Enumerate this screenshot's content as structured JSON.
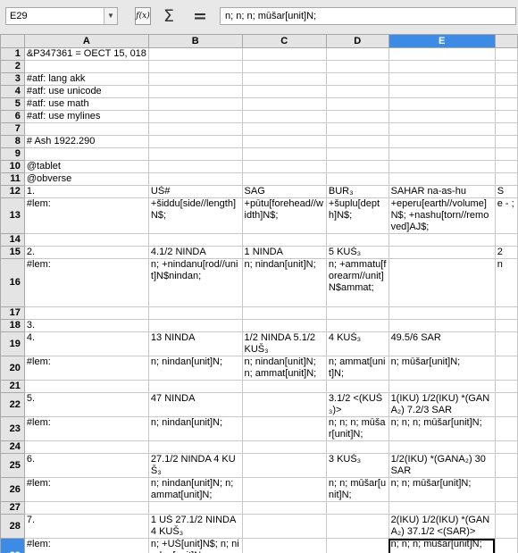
{
  "toolbar": {
    "name_box": "E29",
    "fx_icon": "f(x)",
    "sum_icon": "Σ",
    "equals_icon": "=",
    "formula": "n; n; n; mūšar[unit]N;"
  },
  "columns": [
    "A",
    "B",
    "C",
    "D",
    "E",
    ""
  ],
  "selected_column": "E",
  "selected_row": "29",
  "rows": [
    {
      "num": "1",
      "cells": [
        "&P347361 = OECT 15, 018",
        "",
        "",
        "",
        "",
        ""
      ]
    },
    {
      "num": "2",
      "cells": [
        "",
        "",
        "",
        "",
        "",
        ""
      ]
    },
    {
      "num": "3",
      "cells": [
        "#atf: lang akk",
        "",
        "",
        "",
        "",
        ""
      ]
    },
    {
      "num": "4",
      "cells": [
        "#atf: use unicode",
        "",
        "",
        "",
        "",
        ""
      ]
    },
    {
      "num": "5",
      "cells": [
        "#atf: use math",
        "",
        "",
        "",
        "",
        ""
      ]
    },
    {
      "num": "6",
      "cells": [
        "#atf: use mylines",
        "",
        "",
        "",
        "",
        ""
      ]
    },
    {
      "num": "7",
      "cells": [
        "",
        "",
        "",
        "",
        "",
        ""
      ]
    },
    {
      "num": "8",
      "cells": [
        "# Ash 1922.290",
        "",
        "",
        "",
        "",
        ""
      ]
    },
    {
      "num": "9",
      "cells": [
        "",
        "",
        "",
        "",
        "",
        ""
      ]
    },
    {
      "num": "10",
      "cells": [
        "@tablet",
        "",
        "",
        "",
        "",
        ""
      ]
    },
    {
      "num": "11",
      "cells": [
        "@obverse",
        "",
        "",
        "",
        "",
        ""
      ]
    },
    {
      "num": "12",
      "cells": [
        "1.",
        "UŠ#",
        "SAG",
        "BUR₃",
        "SAHAR na-as-hu",
        "S"
      ]
    },
    {
      "num": "13",
      "cells": [
        "#lem:",
        "+šiddu[side//length]N$;",
        "+pūtu[forehead//width]N$;",
        "+šuplu[depth]N$;",
        "+eperu[earth//volume]N$; +nashu[torn//removed]AJ$;",
        "e - ;"
      ]
    },
    {
      "num": "14",
      "cells": [
        "",
        "",
        "",
        "",
        "",
        ""
      ]
    },
    {
      "num": "15",
      "cells": [
        "2.",
        "4.1/2 NINDA",
        "1 NINDA",
        "5 KUŠ₃",
        "",
        "2"
      ]
    },
    {
      "num": "16",
      "cells": [
        "#lem:",
        "n; +nindanu[rod//unit]N$nindan;",
        "n; nindan[unit]N;",
        "n; +ammatu[forearm//unit]N$ammat;",
        "",
        "n"
      ]
    },
    {
      "num": "17",
      "cells": [
        "",
        "",
        "",
        "",
        "",
        ""
      ]
    },
    {
      "num": "18",
      "cells": [
        "3.",
        "",
        "",
        "",
        "",
        ""
      ]
    },
    {
      "num": "19",
      "cells": [
        "4.",
        "13 NINDA",
        "1/2 NINDA 5.1/2 KUŠ₃",
        "4 KUŠ₃",
        "49.5/6 SAR",
        ""
      ]
    },
    {
      "num": "20",
      "cells": [
        "#lem:",
        "n; nindan[unit]N;",
        "n; nindan[unit]N; n; ammat[unit]N;",
        "n; ammat[unit]N;",
        "n; mūšar[unit]N;",
        ""
      ]
    },
    {
      "num": "21",
      "cells": [
        "",
        "",
        "",
        "",
        "",
        ""
      ]
    },
    {
      "num": "22",
      "cells": [
        "5.",
        "47 NINDA",
        "",
        "3.1/2 <(KUŠ₃)>",
        "1(IKU) 1/2(IKU) *(GANA₂) 7.2/3 SAR",
        ""
      ]
    },
    {
      "num": "23",
      "cells": [
        "#lem:",
        "n; nindan[unit]N;",
        "",
        "n; n; n; mūšar[unit]N;",
        "n; n; n; mūšar[unit]N;",
        ""
      ]
    },
    {
      "num": "24",
      "cells": [
        "",
        "",
        "",
        "",
        "",
        ""
      ]
    },
    {
      "num": "25",
      "cells": [
        "6.",
        "27.1/2 NINDA 4 KUŠ₃",
        "",
        "3 KUŠ₃",
        "1/2(IKU) *(GANA₂) 30 SAR",
        ""
      ]
    },
    {
      "num": "26",
      "cells": [
        "#lem:",
        "n; nindan[unit]N; n; ammat[unit]N;",
        "",
        "n; n; mūšar[unit]N;",
        "n; n; mūšar[unit]N;",
        ""
      ]
    },
    {
      "num": "27",
      "cells": [
        "",
        "",
        "",
        "",
        "",
        ""
      ]
    },
    {
      "num": "28",
      "cells": [
        "7.",
        "1 UŠ 27.1/2 NINDA 4 KUŠ₃",
        "",
        "",
        "2(IKU) 1/2(IKU) *(GANA₂) 37.1/2 <(SAR)>",
        ""
      ]
    },
    {
      "num": "29",
      "cells": [
        "#lem:",
        "n; +UŠ[unit]N$; n; nindan[unit]N; n; ammat[unit]N;",
        "",
        "",
        "n; n; n; mūšar[unit]N;",
        ""
      ]
    }
  ]
}
